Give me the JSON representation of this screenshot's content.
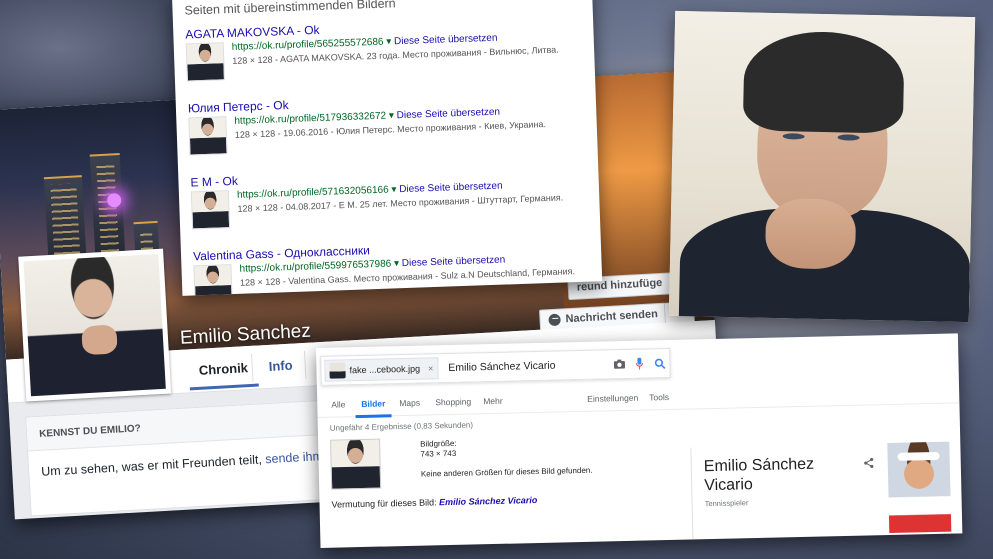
{
  "facebook": {
    "name": "Emilio Sanchez",
    "tabs": [
      "Chronik",
      "Info",
      "Fr"
    ],
    "friend_button": "Freund hinzufügen",
    "friend_button_visible": "reund hinzufüge",
    "message_button": "Nachricht senden",
    "more_button": "···",
    "card_header": "KENNST DU EMILIO?",
    "card_text": "Um zu sehen, was er mit Freunden teilt, ",
    "card_link": "sende ihm eine"
  },
  "results": {
    "heading": "Seiten mit übereinstimmenden Bildern",
    "items": [
      {
        "title": "AGATA MAKOVSKA - Ok",
        "url": "https://ok.ru/profile/565255572686",
        "translate": "Diese Seite übersetzen",
        "desc": "128 × 128 - AGATA MAKOVSKA. 23 года. Место проживания - Вильнюс, Литва."
      },
      {
        "title": "Юлия Петерс - Ok",
        "url": "https://ok.ru/profile/517936332672",
        "translate": "Diese Seite übersetzen",
        "desc": "128 × 128 - 19.06.2016 - Юлия Петерс. Место проживания - Киев, Украина."
      },
      {
        "title": "E M - Ok",
        "url": "https://ok.ru/profile/571632056166",
        "translate": "Diese Seite übersetzen",
        "desc": "128 × 128 - 04.08.2017 - E M. 25 лет. Место проживания - Штуттарт, Германия."
      },
      {
        "title": "Valentina Gass - Одноклассники",
        "url": "https://ok.ru/profile/559976537986",
        "translate": "Diese Seite übersetzen",
        "desc": "128 × 128 - Valentina Gass. Место проживания - Sulz a.N Deutschland, Германия."
      }
    ]
  },
  "search": {
    "chip_label": "fake ...cebook.jpg",
    "chip_close": "×",
    "query": "Emilio Sánchez Vicario",
    "tabs": [
      "Alle",
      "Bilder",
      "Maps",
      "Shopping",
      "Mehr"
    ],
    "active_tab": "Bilder",
    "settings": "Einstellungen",
    "tools": "Tools",
    "result_count": "Ungefähr 4 Ergebnisse (0,83 Sekunden)",
    "size_label": "Bildgröße:",
    "size_value": "743 × 743",
    "no_sizes": "Keine anderen Größen für dieses Bild gefunden.",
    "guess_label": "Vermutung für dieses Bild:",
    "guess_value": "Emilio Sánchez Vicario",
    "kp_name": "Emilio Sánchez Vicario",
    "kp_subtitle": "Tennisspieler"
  },
  "colors": {
    "fb_blue": "#4267b2",
    "google_link": "#1a0dab",
    "google_green": "#006621",
    "google_blue": "#1a73e8"
  }
}
